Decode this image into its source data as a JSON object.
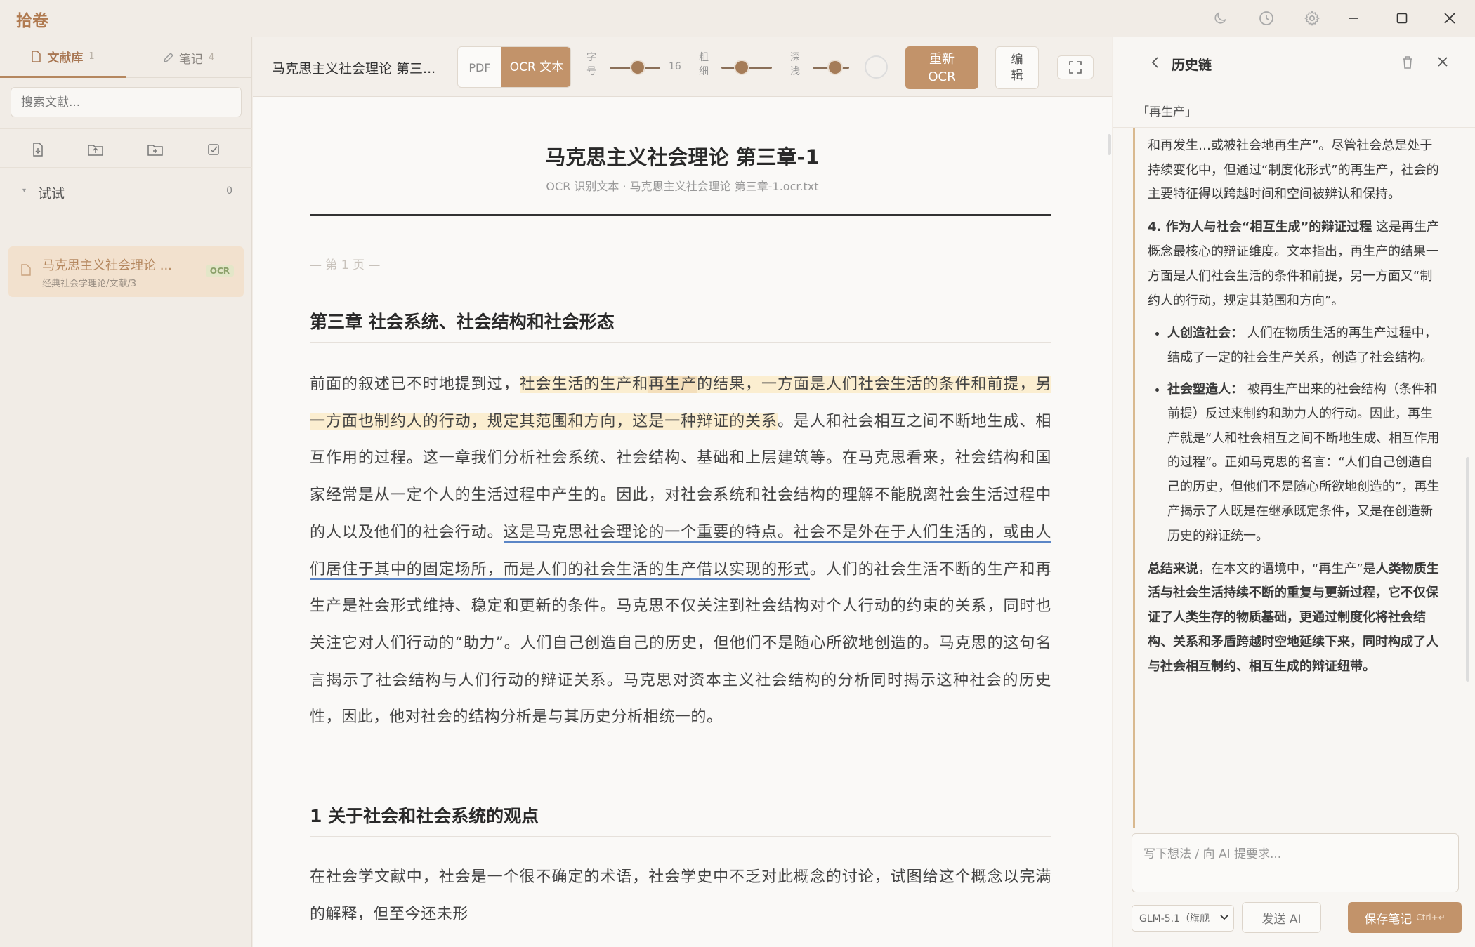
{
  "app": {
    "title": "拾卷"
  },
  "titlebar": {
    "icons": [
      "moon-icon",
      "history-icon",
      "gear-icon",
      "minimize-icon",
      "maximize-icon",
      "close-icon"
    ]
  },
  "sidebar": {
    "tabs": [
      {
        "label": "文献库",
        "count": "1",
        "icon": "document-icon"
      },
      {
        "label": "笔记",
        "count": "4",
        "icon": "pen-icon"
      }
    ],
    "search_placeholder": "搜索文献...",
    "tools": [
      "import-file-icon",
      "upload-icon",
      "new-folder-icon",
      "batch-select-icon"
    ],
    "folder": {
      "name": "试试",
      "count": "0"
    },
    "doc": {
      "title": "马克思主义社会理论 ...",
      "path": "经典社会学理论/文献/3",
      "badge": "OCR"
    }
  },
  "toolbar": {
    "doc_name": "马克思主义社会理论 第三...",
    "view_pdf": "PDF",
    "view_ocr": "OCR 文本",
    "font_size_label": "字号",
    "font_size_value": "16",
    "weight_label": "粗细",
    "shade_label": "深浅",
    "reocr_label": "重新 OCR",
    "edit_label": "编辑",
    "levels": {
      "font_size": 0.55,
      "weight": 0.4,
      "shade": 0.62
    }
  },
  "reader": {
    "title": "马克思主义社会理论 第三章-1",
    "subtitle": "OCR 识别文本 · 马克思主义社会理论 第三章-1.ocr.txt",
    "page_marker": "— 第 1 页 —",
    "section1": "第三章 社会系统、社会结构和社会形态",
    "p1": {
      "a": "前面的叙述已不时地提到过，",
      "b": "社会生活的生产和",
      "c": "再生产",
      "d": "的结果，一方面是人们社会生活的条件和前提，另一方面也制约人的行动，规定其范围和方向，这是一种辩证的关系",
      "e": "。是人和社会相互之间不断地生成、相互作用的过程。这一章我们分析社会系统、社会结构、基础和上层建筑等。在马克思看来，社会结构和国家经常是从一定个人的生活过程中产生的。因此，对社会系统和社会结构的理解不能脱离社会生活过程中的人以及他们的社会行动。",
      "f": "这是马克思社会理论的一个重要的特点。社会不是外在于人们生活的，或由人们居住于其中的固定场所，而是人们的社会生活的生产借以实现的形式",
      "g": "。人们的社会生活不断的生产和再生产是社会形式维持、稳定和更新的条件。马克思不仅关注到社会结构对个人行动的约束的关系，同时也关注它对人们行动的“助力”。人们自己创造自己的历史，但他们不是随心所欲地创造的。马克思的这句名言揭示了社会结构与人们行动的辩证关系。马克思对资本主义社会结构的分析同时揭示这种社会的历史性，因此，他对社会的结构分析是与其历史分析相统一的。"
    },
    "section2": "1 关于社会和社会系统的观点",
    "p2": "在社会学文献中，社会是一个很不确定的术语，社会学史中不乏对此概念的讨论，试图给这个概念以完满的解释，但至今还未形"
  },
  "panel": {
    "title": "历史链",
    "tag": "「再生产」",
    "para1": "空的再生产”。在这里，再生产表现为社会行为“发生和再发生…或被社会地再生产”。尽管社会总是处于持续变化中，但通过“制度化形式”的再生产，社会的主要特征得以跨越时间和空间被辨认和保持。",
    "point4_bold": "4. 作为人与社会“相互生成”的辩证过程",
    "point4_text": " 这是再生产概念最核心的辩证维度。文本指出，再生产的结果一方面是人们社会生活的条件和前提，另一方面又“制约人的行动，规定其范围和方向”。",
    "bullet1_bold": "人创造社会：",
    "bullet1_text": " 人们在物质生活的再生产过程中，结成了一定的社会生产关系，创造了社会结构。",
    "bullet2_bold": "社会塑造人：",
    "bullet2_text": " 被再生产出来的社会结构（条件和前提）反过来制约和助力人的行动。因此，再生产就是“人和社会相互之间不断地生成、相互作用的过程”。正如马克思的名言：“人们自己创造自己的历史，但他们不是随心所欲地创造的”，再生产揭示了人既是在继承既定条件，又是在创造新历史的辩证统一。",
    "summary_lead": "总结来说",
    "summary_mid": "，在本文的语境中，“再生产”是",
    "summary_bold": "人类物质生活与社会生活持续不断的重复与更新过程，它不仅保证了人类生存的物质基础，更通过制度化将社会结构、关系和矛盾跨越时空地延续下来，同时构成了人与社会相互制约、相互生成的辩证纽带。",
    "note_placeholder": "写下想法 / 向 AI 提要求...",
    "model": "GLM-5.1（旗舰",
    "send_label": "发送 AI",
    "save_label": "保存笔记",
    "save_shortcut": "Ctrl+↵"
  }
}
